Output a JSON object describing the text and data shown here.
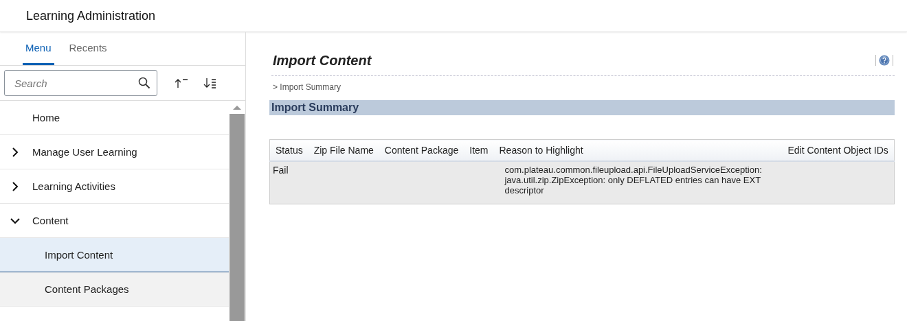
{
  "header": {
    "title": "Learning Administration"
  },
  "sidebar": {
    "tabs": [
      {
        "label": "Menu",
        "selected": true
      },
      {
        "label": "Recents",
        "selected": false
      }
    ],
    "search": {
      "placeholder": "Search"
    },
    "items": [
      {
        "label": "Home",
        "kind": "leaf",
        "selected": false
      },
      {
        "label": "Manage User Learning",
        "kind": "folder",
        "expanded": false,
        "selected": false
      },
      {
        "label": "Learning Activities",
        "kind": "folder",
        "expanded": false,
        "selected": false
      },
      {
        "label": "Content",
        "kind": "folder",
        "expanded": true,
        "selected": false,
        "children": [
          {
            "label": "Import Content",
            "kind": "leaf",
            "selected": true
          },
          {
            "label": "Content Packages",
            "kind": "leaf",
            "selected": false
          }
        ]
      }
    ]
  },
  "page": {
    "title": "Import Content",
    "breadcrumb": "> Import Summary",
    "section": "Import Summary",
    "table": {
      "columns": [
        "Status",
        "Zip File Name",
        "Content Package",
        "Item",
        "Reason to Highlight",
        "Edit Content Object IDs"
      ],
      "rows": [
        [
          "Fail",
          "",
          "",
          "",
          "com.plateau.common.fileupload.api.FileUploadServiceException: java.util.zip.ZipException: only DEFLATED entries can have EXT descriptor",
          ""
        ]
      ]
    }
  }
}
